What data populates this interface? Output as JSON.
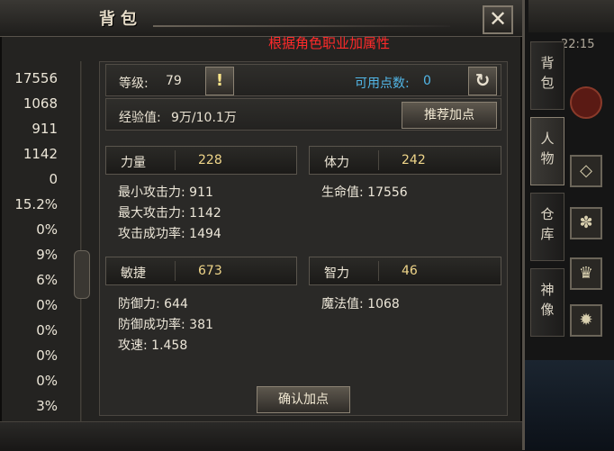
{
  "window": {
    "title": "背包",
    "close_icon": "close-x-icon",
    "hint": "根据角色职业加属性"
  },
  "left_values": [
    "17556",
    "1068",
    "911",
    "1142",
    "0",
    "15.2%",
    "0%",
    "9%",
    "6%",
    "0%",
    "0%",
    "0%",
    "0%",
    "3%"
  ],
  "level": {
    "label": "等级:",
    "value": "79",
    "tip_icon": "exclamation-icon"
  },
  "points": {
    "label": "可用点数:",
    "value": "0",
    "reset_icon": "refresh-icon"
  },
  "exp": {
    "label": "经验值:",
    "value": "9万/10.1万"
  },
  "recommend_label": "推荐加点",
  "stats": {
    "strength": {
      "name": "力量",
      "value": "228"
    },
    "stamina": {
      "name": "体力",
      "value": "242"
    },
    "agility": {
      "name": "敏捷",
      "value": "673"
    },
    "intellect": {
      "name": "智力",
      "value": "46"
    }
  },
  "attributes": {
    "min_attack": "最小攻击力: 911",
    "max_attack": "最大攻击力: 1142",
    "hit_rate": "攻击成功率: 1494",
    "hp": "生命值: 17556",
    "defense": "防御力: 644",
    "defense_rate": "防御成功率: 381",
    "attack_speed": "攻速: 1.458",
    "mana": "魔法值: 1068"
  },
  "confirm_label": "确认加点",
  "side": {
    "time": "22:15",
    "tabs": [
      {
        "chars": [
          "背",
          "包"
        ]
      },
      {
        "chars": [
          "人",
          "物"
        ]
      },
      {
        "chars": [
          "仓",
          "库"
        ]
      },
      {
        "chars": [
          "神",
          "像"
        ]
      }
    ],
    "icons": [
      "diamond-icon",
      "paw-icon",
      "trophy-icon",
      "gear-icon"
    ]
  },
  "accent": {
    "hint_color": "#ff2a2a",
    "points_color": "#52b7e8",
    "value_color": "#f0d68a"
  }
}
